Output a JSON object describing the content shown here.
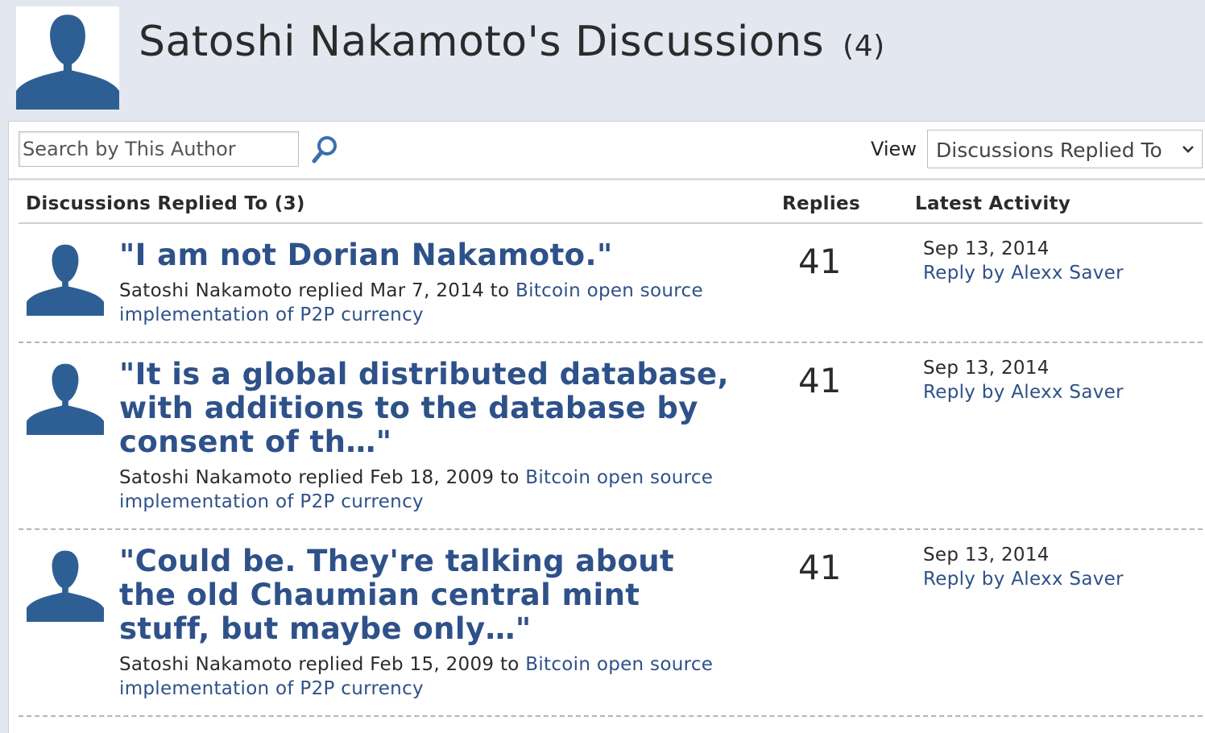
{
  "header": {
    "title": "Satoshi Nakamoto's Discussions",
    "count": "(4)"
  },
  "toolbar": {
    "search_placeholder": "Search by This Author",
    "view_label": "View",
    "view_selected": "Discussions Replied To"
  },
  "columns": {
    "discussions": "Discussions Replied To (3)",
    "replies": "Replies",
    "latest_activity": "Latest Activity"
  },
  "rows": [
    {
      "title": "\"I am not Dorian Nakamoto.\"",
      "meta_prefix": "Satoshi Nakamoto replied Mar 7, 2014 to ",
      "forum": "Bitcoin open source implementation of P2P currency",
      "replies": "41",
      "activity_date": "Sep 13, 2014",
      "activity_link": "Reply by Alexx Saver"
    },
    {
      "title": "\"It is a global distributed database, with additions to the database by consent of th…\"",
      "meta_prefix": "Satoshi Nakamoto replied Feb 18, 2009 to ",
      "forum": "Bitcoin open source implementation of P2P currency",
      "replies": "41",
      "activity_date": "Sep 13, 2014",
      "activity_link": "Reply by Alexx Saver"
    },
    {
      "title": "\"Could be. They're talking about the old Chaumian central mint stuff, but maybe only…\"",
      "meta_prefix": "Satoshi Nakamoto replied Feb 15, 2009 to ",
      "forum": "Bitcoin open source implementation of P2P currency",
      "replies": "41",
      "activity_date": "Sep 13, 2014",
      "activity_link": "Reply by Alexx Saver"
    }
  ],
  "colors": {
    "link": "#2e5189",
    "avatar": "#2e5f94",
    "header_bg": "#e3e7ef"
  }
}
